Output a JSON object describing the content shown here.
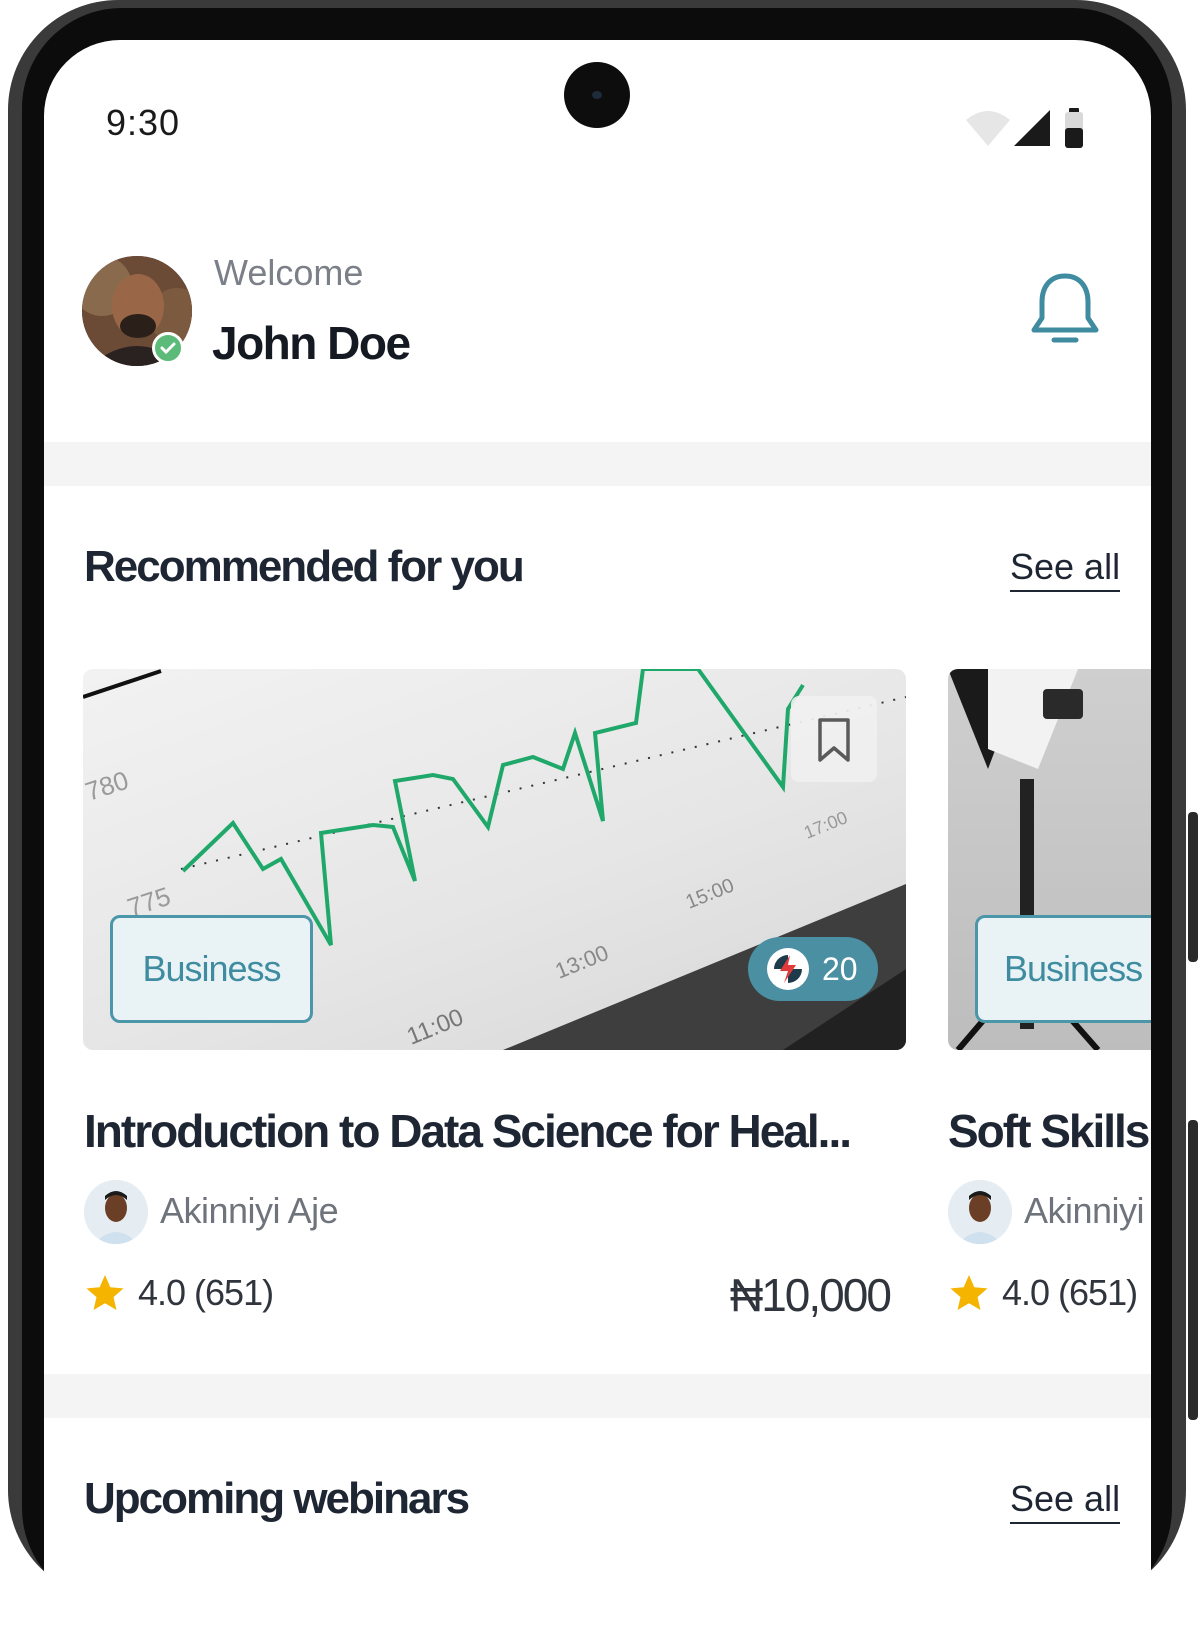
{
  "status_bar": {
    "time": "9:30"
  },
  "header": {
    "greeting": "Welcome",
    "user_name": "John Doe"
  },
  "recommended": {
    "title": "Recommended for you",
    "see_all": "See all",
    "courses": [
      {
        "category": "Business",
        "points": "20",
        "title": "Introduction to Data Science for Heal...",
        "instructor": "Akinniyi Aje",
        "rating": "4.0 (651)",
        "price": "₦10,000",
        "chart_labels": [
          "780",
          "775",
          "11:00",
          "13:00",
          "15:00",
          "17:00"
        ]
      },
      {
        "category": "Business",
        "title": "Soft Skills",
        "instructor": "Akinniyi",
        "rating": "4.0 (651)"
      }
    ]
  },
  "webinars": {
    "title": "Upcoming webinars",
    "see_all": "See all"
  },
  "colors": {
    "accent": "#4b96a9",
    "tag_bg": "#e9f3f6",
    "star": "#f5b400",
    "chart_line": "#1fa86a"
  }
}
